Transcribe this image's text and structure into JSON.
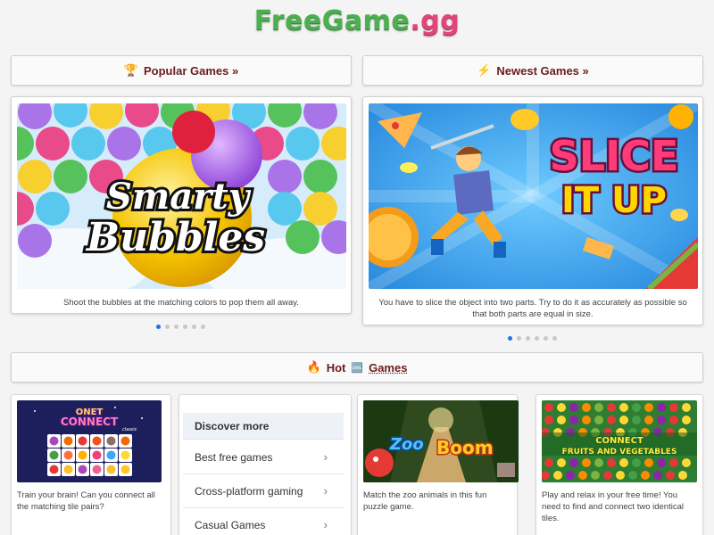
{
  "site": {
    "logo_part1": "FreeGame",
    "logo_part2": ".gg"
  },
  "sections": {
    "popular": {
      "icon": "trophy-icon",
      "emoji": "🏆",
      "label": "Popular Games »"
    },
    "newest": {
      "icon": "lightning-icon",
      "emoji": "⚡",
      "label": "Newest Games »"
    },
    "hot": {
      "icon": "fire-icon",
      "emoji": "🔥",
      "label": "Hot",
      "ad_icon": "ad-icon",
      "ad_glyph": "🆒",
      "label2": "Games"
    }
  },
  "featured": [
    {
      "title": "Smarty Bubbles",
      "image_text": "Smarty Bubbles",
      "description": "Shoot the bubbles at the matching colors to pop them all away."
    },
    {
      "title": "Slice It Up",
      "image_text_1": "SLICE",
      "image_text_2": "IT UP",
      "description": "You have to slice the object into two parts. Try to do it as accurately as possible so that both parts are equal in size."
    }
  ],
  "carousel_dots": 6,
  "games": [
    {
      "title": "Onet Connect Classic",
      "image_text_1": "ONET",
      "image_text_2": "CONNECT",
      "image_text_3": "classic",
      "description": "Train your brain! Can you connect all the matching tile pairs?"
    },
    {
      "title": "Zoo Boom",
      "image_text_1": "Zoo",
      "image_text_2": "Boom",
      "description": "Match the zoo animals in this fun puzzle game."
    },
    {
      "title": "Connect Fruits and Vegetables",
      "image_text_1": "CONNECT",
      "image_text_2": "FRUITS AND VEGETABLES",
      "description": "Play and relax in your free time! You need to find and connect two identical tiles."
    }
  ],
  "discover": {
    "heading": "Discover more",
    "items": [
      {
        "label": "Best free games"
      },
      {
        "label": "Cross-platform gaming"
      },
      {
        "label": "Casual Games"
      }
    ],
    "chevron": "›"
  },
  "colors": {
    "logo_green": "#4caf50",
    "logo_pink": "#e0457b",
    "section_text": "#6b1c1c",
    "dot_active": "#1a73e8"
  }
}
